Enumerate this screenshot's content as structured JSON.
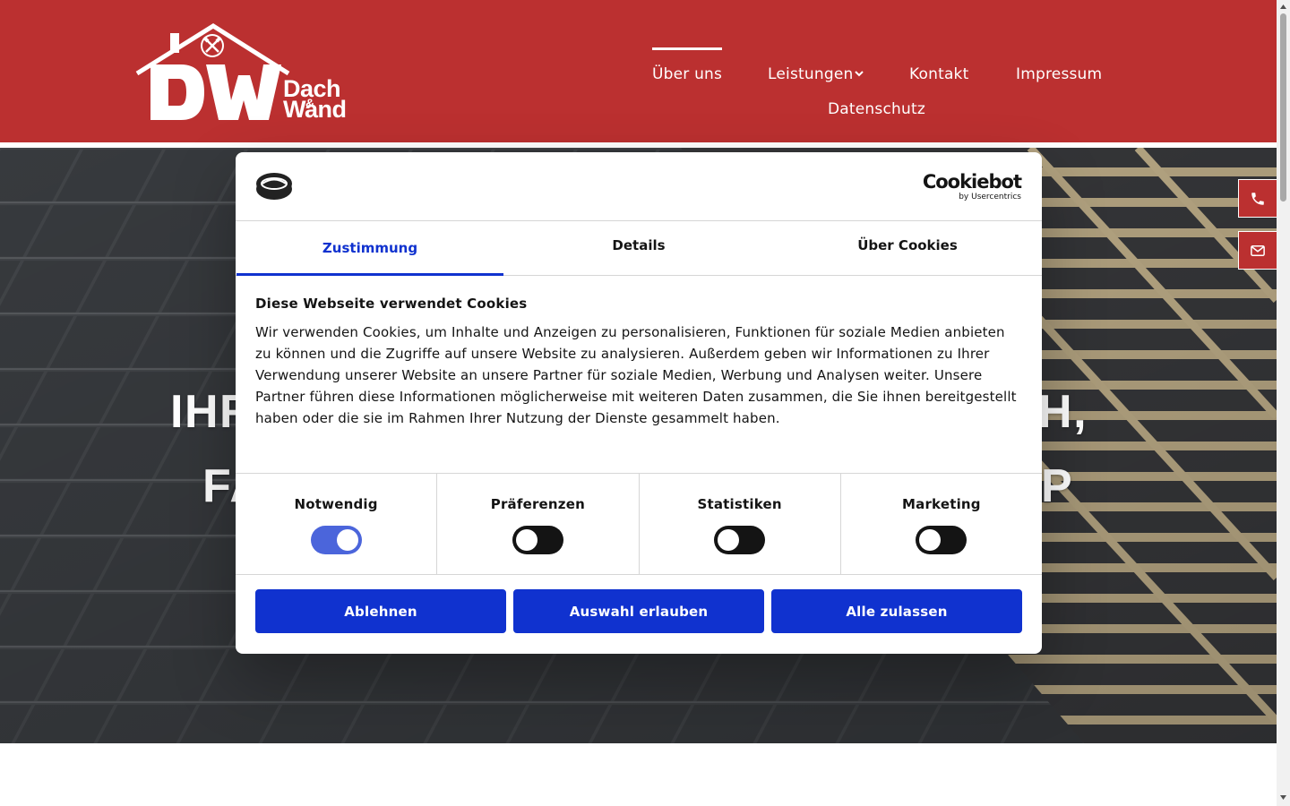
{
  "header": {
    "logo": {
      "brand_letters": "DW",
      "word1": "Dach",
      "ampersand": "&",
      "word2": "Wand"
    },
    "nav": [
      {
        "label": "Über uns",
        "active": true
      },
      {
        "label": "Leistungen",
        "has_dropdown": true
      },
      {
        "label": "Kontakt"
      },
      {
        "label": "Impressum"
      },
      {
        "label": "Datenschutz"
      }
    ]
  },
  "hero": {
    "line1_left": "IHR",
    "line1_right": "CH,",
    "line2_left": "FA",
    "line2_right": "P"
  },
  "side_buttons": [
    {
      "icon": "phone-icon"
    },
    {
      "icon": "mail-icon"
    }
  ],
  "cookie_dialog": {
    "provider": {
      "name": "Cookiebot",
      "sub": "by Usercentrics"
    },
    "tabs": [
      {
        "label": "Zustimmung",
        "active": true
      },
      {
        "label": "Details"
      },
      {
        "label": "Über Cookies"
      }
    ],
    "heading": "Diese Webseite verwendet Cookies",
    "body": "Wir verwenden Cookies, um Inhalte und Anzeigen zu personalisieren, Funktionen für soziale Medien anbieten zu können und die Zugriffe auf unsere Website zu analysieren. Außerdem geben wir Informationen zu Ihrer Verwendung unserer Website an unsere Partner für soziale Medien, Werbung und Analysen weiter. Unsere Partner führen diese Informationen möglicherweise mit weiteren Daten zusammen, die Sie ihnen bereitgestellt haben oder die sie im Rahmen Ihrer Nutzung der Dienste gesammelt haben.",
    "consents": [
      {
        "label": "Notwendig",
        "checked": true,
        "disabled": true
      },
      {
        "label": "Präferenzen",
        "checked": false
      },
      {
        "label": "Statistiken",
        "checked": false
      },
      {
        "label": "Marketing",
        "checked": false
      }
    ],
    "buttons": {
      "decline": "Ablehnen",
      "allow_selection": "Auswahl erlauben",
      "allow_all": "Alle zulassen"
    }
  },
  "colors": {
    "brand_red": "#bb3030",
    "cookie_blue": "#1032cf",
    "text_dark": "#141414"
  }
}
